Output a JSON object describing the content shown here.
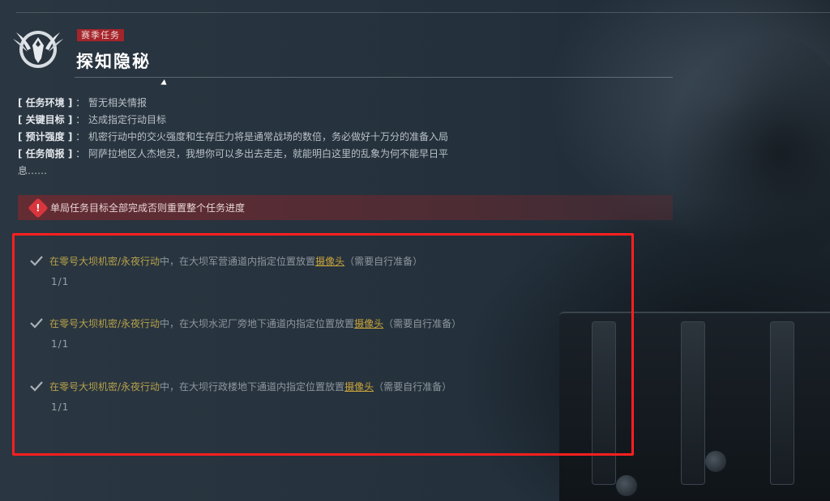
{
  "header": {
    "tag": "赛季任务",
    "title": "探知隐秘"
  },
  "info": [
    {
      "label": "[ 任务环境 ]",
      "value": "暂无相关情报"
    },
    {
      "label": "[ 关键目标 ]",
      "value": "达成指定行动目标"
    },
    {
      "label": "[ 预计强度 ]",
      "value": "机密行动中的交火强度和生存压力将是通常战场的数倍，务必做好十万分的准备入局"
    },
    {
      "label": "[ 任务简报 ]",
      "value": "阿萨拉地区人杰地灵，我想你可以多出去走走，就能明白这里的乱象为何不能早日平"
    }
  ],
  "info_continuation": "息……",
  "warning": {
    "icon": "warning-icon",
    "text": "单局任务目标全部完成否则重置整个任务进度"
  },
  "tasks": [
    {
      "prefix": "在零号大坝机密/永夜行动",
      "mid": "中，在大坝军营通道内指定位置放置",
      "item": "摄像头",
      "suffix": "（需要自行准备）",
      "progress": "1/1"
    },
    {
      "prefix": "在零号大坝机密/永夜行动",
      "mid": "中，在大坝水泥厂旁地下通道内指定位置放置",
      "item": "摄像头",
      "suffix": "（需要自行准备）",
      "progress": "1/1"
    },
    {
      "prefix": "在零号大坝机密/永夜行动",
      "mid": "中，在大坝行政楼地下通道内指定位置放置",
      "item": "摄像头",
      "suffix": "（需要自行准备）",
      "progress": "1/1"
    }
  ],
  "colors": {
    "accent_red": "#a3242a",
    "highlight_yellow": "#c9a43c",
    "annotation_box": "#ff1f1f"
  }
}
